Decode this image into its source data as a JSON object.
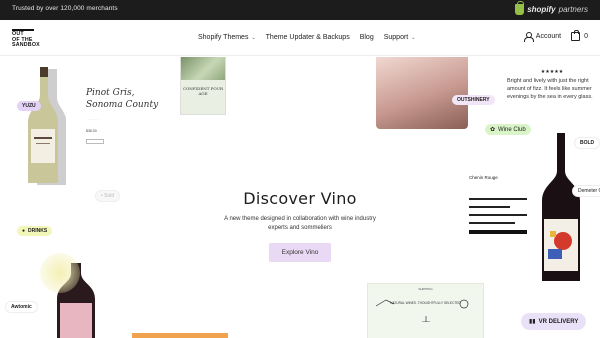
{
  "announcement": {
    "text": "Trusted by over 120,000 merchants"
  },
  "partner_badge": {
    "brand": "shopify",
    "suffix": "partners",
    "icon": "shopify-bag-icon"
  },
  "brand": {
    "logo_lines": [
      "OUT",
      "OF THE",
      "SANDBOX"
    ]
  },
  "nav": {
    "items": [
      {
        "label": "Shopify Themes",
        "dropdown": true
      },
      {
        "label": "Theme Updater & Backups",
        "dropdown": false
      },
      {
        "label": "Blog",
        "dropdown": false
      },
      {
        "label": "Support",
        "dropdown": true
      }
    ]
  },
  "header_actions": {
    "account_label": "Account",
    "cart_count": "0"
  },
  "hero": {
    "title": "Discover Vino",
    "description": "A new theme designed in collaboration with wine industry experts and sommeliers",
    "cta_label": "Explore Vino"
  },
  "collage": {
    "product": {
      "title": "Pinot Gris, Sonoma County",
      "price": "$36.00"
    },
    "poster_text": "CONFIDENT POUR AGE",
    "review": {
      "stars": "★★★★★",
      "text": "Bright and lively with just the right amount of fizz. It feels like summer evenings by the sea in every glass."
    },
    "sold_out": "• Sold",
    "chenin": {
      "title": "Chenin Rouge"
    },
    "banner_text": "NATURAL WINES. THOUGHTFULLY SELECTED",
    "banner_head": "SHIPPING",
    "labels": {
      "yuzu": "YUZU",
      "outshinery": "OUTSHINERY",
      "wine_club": "Wine Club",
      "bold": "BOLD",
      "demeter": "Demeter Ce",
      "drinks": "DRINKS",
      "awtomic": "Awtomic",
      "delivery": "VR DELIVERY"
    }
  },
  "colors": {
    "topbar": "#1c1c1c",
    "cta_bg": "#ead9f4",
    "wine_club_bg": "#d9f5c8",
    "drinks_bg": "#f3f6b9",
    "yuzu_bg": "#e4d2f6"
  }
}
